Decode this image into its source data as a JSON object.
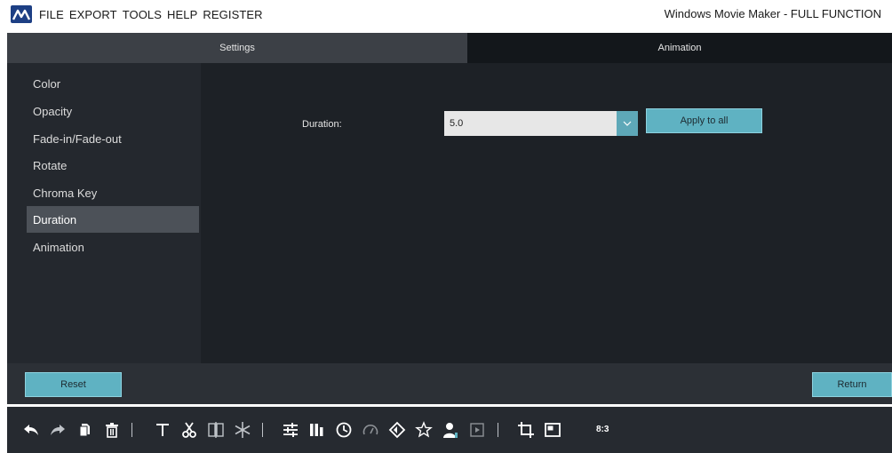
{
  "menubar": {
    "items": [
      "FILE",
      "EXPORT",
      "TOOLS",
      "HELP",
      "REGISTER"
    ],
    "app_title": "Windows Movie Maker - FULL FUNCTION"
  },
  "tabs": {
    "settings": "Settings",
    "animation": "Animation"
  },
  "sidebar": {
    "items": [
      "Color",
      "Opacity",
      "Fade-in/Fade-out",
      "Rotate",
      "Chroma Key",
      "Duration",
      "Animation"
    ],
    "active": "Duration"
  },
  "duration": {
    "label": "Duration:",
    "value": "5.0",
    "apply_label": "Apply to all"
  },
  "bottom": {
    "reset_label": "Reset",
    "return_label": "Return"
  },
  "toolbar": {
    "icons": [
      "undo-icon",
      "redo-icon",
      "copy-icon",
      "delete-icon",
      "text-icon",
      "cut-icon",
      "split-icon",
      "freeze-icon",
      "adjust-icon",
      "equalizer-icon",
      "clock-icon",
      "speed-icon",
      "rotate-icon",
      "star-icon",
      "person-icon",
      "media-icon",
      "crop-icon",
      "mosaic-icon"
    ],
    "ratio_label": "8:3"
  },
  "colors": {
    "accent": "#5fb2c2",
    "panel": "#1d2126",
    "sidebar_active": "#4c5158"
  }
}
